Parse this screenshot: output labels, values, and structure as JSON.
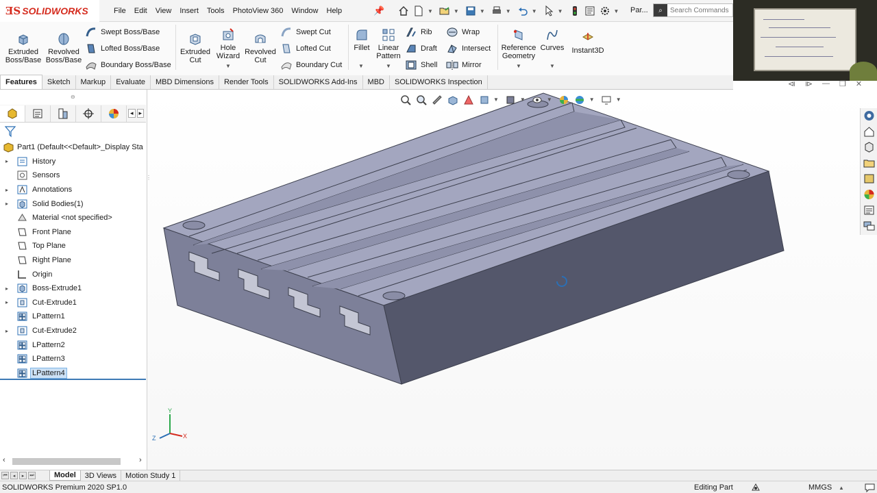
{
  "app": {
    "brand": "SOLIDWORKS",
    "part_label": "Par...",
    "search_placeholder": "Search Commands"
  },
  "menu": [
    "File",
    "Edit",
    "View",
    "Insert",
    "Tools",
    "PhotoView 360",
    "Window",
    "Help"
  ],
  "commands": {
    "extruded_boss": "Extruded\nBoss/Base",
    "revolved_boss": "Revolved\nBoss/Base",
    "swept_boss": "Swept Boss/Base",
    "lofted_boss": "Lofted Boss/Base",
    "boundary_boss": "Boundary Boss/Base",
    "extruded_cut": "Extruded\nCut",
    "hole_wizard": "Hole\nWizard",
    "revolved_cut": "Revolved\nCut",
    "swept_cut": "Swept Cut",
    "lofted_cut": "Lofted Cut",
    "boundary_cut": "Boundary Cut",
    "fillet": "Fillet",
    "linear_pattern": "Linear\nPattern",
    "rib": "Rib",
    "draft": "Draft",
    "shell": "Shell",
    "wrap": "Wrap",
    "intersect": "Intersect",
    "mirror": "Mirror",
    "reference_geometry": "Reference\nGeometry",
    "curves": "Curves",
    "instant3d": "Instant3D"
  },
  "tabs": [
    "Features",
    "Sketch",
    "Markup",
    "Evaluate",
    "MBD Dimensions",
    "Render Tools",
    "SOLIDWORKS Add-Ins",
    "MBD",
    "SOLIDWORKS Inspection"
  ],
  "active_tab": "Features",
  "tree": {
    "root": "Part1  (Default<<Default>_Display Sta",
    "items": [
      {
        "label": "History",
        "expandable": true,
        "icon": "history-icon"
      },
      {
        "label": "Sensors",
        "expandable": false,
        "icon": "sensors-icon"
      },
      {
        "label": "Annotations",
        "expandable": true,
        "icon": "annotations-icon"
      },
      {
        "label": "Solid Bodies(1)",
        "expandable": true,
        "icon": "solid-bodies-icon"
      },
      {
        "label": "Material <not specified>",
        "expandable": false,
        "icon": "material-icon"
      },
      {
        "label": "Front Plane",
        "expandable": false,
        "icon": "plane-icon"
      },
      {
        "label": "Top Plane",
        "expandable": false,
        "icon": "plane-icon"
      },
      {
        "label": "Right Plane",
        "expandable": false,
        "icon": "plane-icon"
      },
      {
        "label": "Origin",
        "expandable": false,
        "icon": "origin-icon"
      },
      {
        "label": "Boss-Extrude1",
        "expandable": true,
        "icon": "boss-extrude-icon"
      },
      {
        "label": "Cut-Extrude1",
        "expandable": true,
        "icon": "cut-extrude-icon"
      },
      {
        "label": "LPattern1",
        "expandable": false,
        "icon": "linear-pattern-icon"
      },
      {
        "label": "Cut-Extrude2",
        "expandable": true,
        "icon": "cut-extrude-icon"
      },
      {
        "label": "LPattern2",
        "expandable": false,
        "icon": "linear-pattern-icon"
      },
      {
        "label": "LPattern3",
        "expandable": false,
        "icon": "linear-pattern-icon"
      },
      {
        "label": "LPattern4",
        "expandable": false,
        "icon": "linear-pattern-icon",
        "selected": true
      }
    ]
  },
  "bottom_tabs": [
    "Model",
    "3D Views",
    "Motion Study 1"
  ],
  "status": {
    "version": "SOLIDWORKS Premium 2020 SP1.0",
    "mode": "Editing Part",
    "units": "MMGS"
  },
  "triad": {
    "x": "X",
    "y": "Y",
    "z": "Z"
  },
  "colors": {
    "accent": "#3d7ab5",
    "model_top": "#a0a3bd",
    "model_front": "#787b95",
    "model_side": "#54576b",
    "brand_red": "#d52b1e",
    "selection": "#cce1f5"
  }
}
